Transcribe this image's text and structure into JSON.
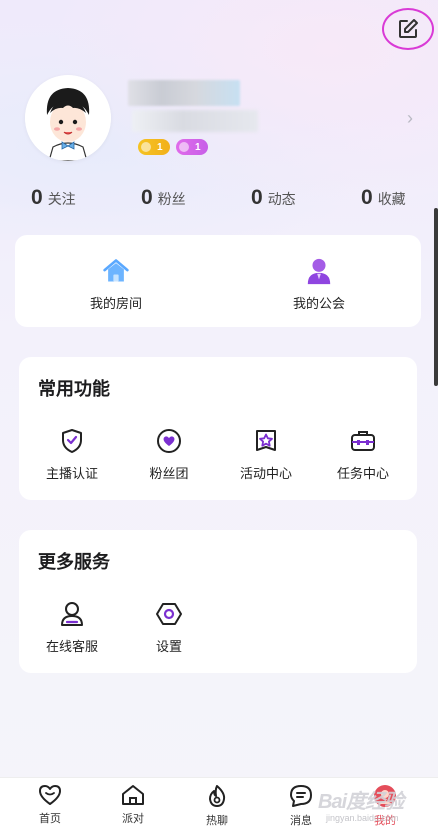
{
  "profile": {
    "badge_gold": "1",
    "badge_pink": "1"
  },
  "stats": [
    {
      "num": "0",
      "label": "关注"
    },
    {
      "num": "0",
      "label": "粉丝"
    },
    {
      "num": "0",
      "label": "动态"
    },
    {
      "num": "0",
      "label": "收藏"
    }
  ],
  "quick_links": [
    {
      "label": "我的房间",
      "icon": "house-icon"
    },
    {
      "label": "我的公会",
      "icon": "person-icon"
    }
  ],
  "common": {
    "title": "常用功能",
    "items": [
      {
        "label": "主播认证",
        "icon": "shield-check-icon"
      },
      {
        "label": "粉丝团",
        "icon": "heart-circle-icon"
      },
      {
        "label": "活动中心",
        "icon": "star-badge-icon"
      },
      {
        "label": "任务中心",
        "icon": "toolbox-icon"
      }
    ]
  },
  "more": {
    "title": "更多服务",
    "items": [
      {
        "label": "在线客服",
        "icon": "user-service-icon"
      },
      {
        "label": "设置",
        "icon": "hexagon-gear-icon"
      }
    ]
  },
  "tabs": [
    {
      "label": "首页",
      "icon": "heart-icon"
    },
    {
      "label": "派对",
      "icon": "home-icon"
    },
    {
      "label": "热聊",
      "icon": "flame-icon"
    },
    {
      "label": "消息",
      "icon": "chat-icon"
    },
    {
      "label": "我的",
      "icon": "me-avatar-icon"
    }
  ],
  "colors": {
    "accent_purple": "#7b2fd0",
    "active_tab": "#e44d5a",
    "edit_highlight": "#d93ad6"
  },
  "watermark": {
    "main": "Bai度经验",
    "sub": "jingyan.baidu.com"
  }
}
